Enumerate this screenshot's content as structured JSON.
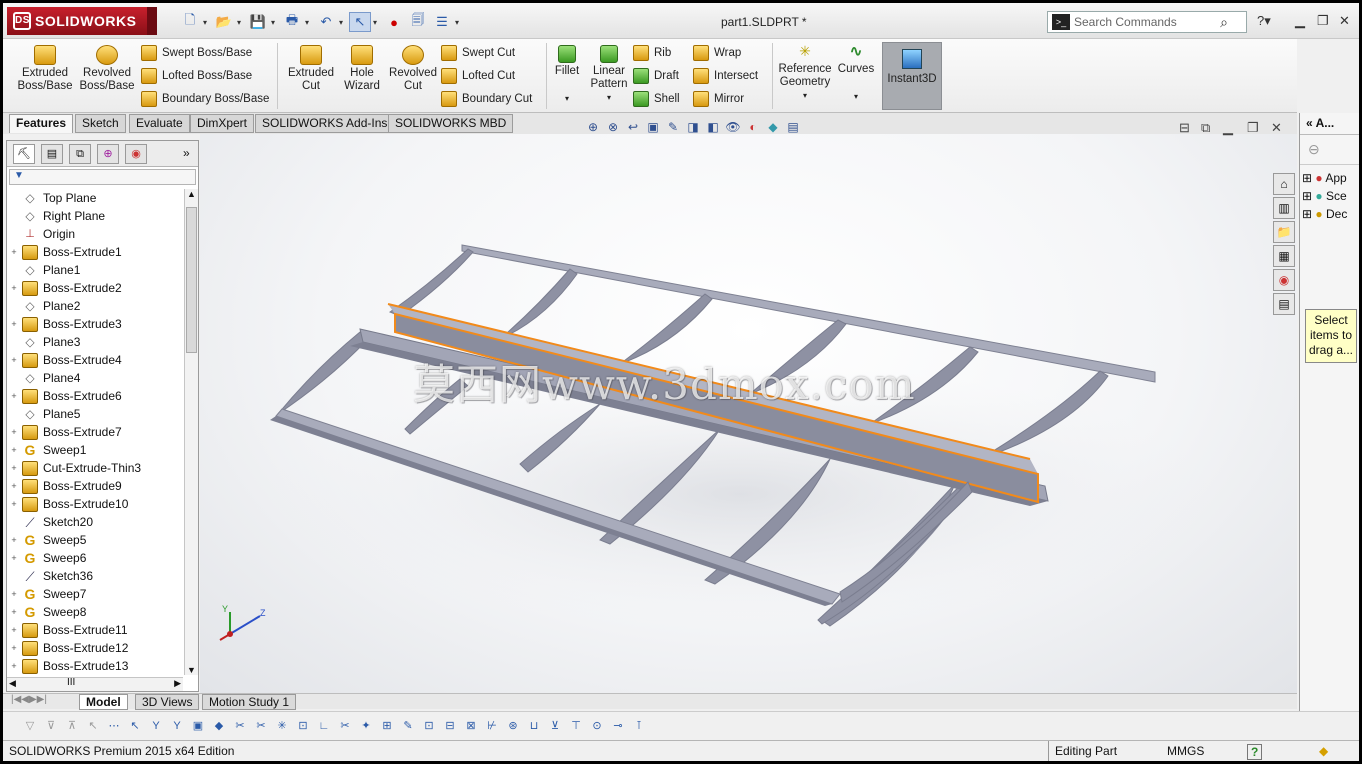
{
  "app": {
    "brand": "SOLIDWORKS",
    "document_title": "part1.SLDPRT *"
  },
  "search": {
    "placeholder": "Search Commands"
  },
  "ribbon": {
    "extruded_boss": "Extruded Boss/Base",
    "revolved_boss": "Revolved Boss/Base",
    "swept_boss": "Swept Boss/Base",
    "lofted_boss": "Lofted Boss/Base",
    "boundary_boss": "Boundary Boss/Base",
    "extruded_cut": "Extruded Cut",
    "hole_wizard": "Hole Wizard",
    "revolved_cut": "Revolved Cut",
    "swept_cut": "Swept Cut",
    "lofted_cut": "Lofted Cut",
    "boundary_cut": "Boundary Cut",
    "fillet": "Fillet",
    "linear_pattern": "Linear Pattern",
    "rib": "Rib",
    "draft": "Draft",
    "shell": "Shell",
    "wrap": "Wrap",
    "intersect": "Intersect",
    "mirror": "Mirror",
    "reference_geometry": "Reference Geometry",
    "curves": "Curves",
    "instant3d": "Instant3D"
  },
  "tabs": [
    "Features",
    "Sketch",
    "Evaluate",
    "DimXpert",
    "SOLIDWORKS Add-Ins",
    "SOLIDWORKS MBD"
  ],
  "feature_tree": [
    {
      "label": "Top Plane",
      "type": "plane",
      "expand": ""
    },
    {
      "label": "Right Plane",
      "type": "plane",
      "expand": ""
    },
    {
      "label": "Origin",
      "type": "origin",
      "expand": ""
    },
    {
      "label": "Boss-Extrude1",
      "type": "extrude",
      "expand": "+"
    },
    {
      "label": "Plane1",
      "type": "plane",
      "expand": ""
    },
    {
      "label": "Boss-Extrude2",
      "type": "extrude",
      "expand": "+"
    },
    {
      "label": "Plane2",
      "type": "plane",
      "expand": ""
    },
    {
      "label": "Boss-Extrude3",
      "type": "extrude",
      "expand": "+"
    },
    {
      "label": "Plane3",
      "type": "plane",
      "expand": ""
    },
    {
      "label": "Boss-Extrude4",
      "type": "extrude",
      "expand": "+"
    },
    {
      "label": "Plane4",
      "type": "plane",
      "expand": ""
    },
    {
      "label": "Boss-Extrude6",
      "type": "extrude",
      "expand": "+"
    },
    {
      "label": "Plane5",
      "type": "plane",
      "expand": ""
    },
    {
      "label": "Boss-Extrude7",
      "type": "extrude",
      "expand": "+"
    },
    {
      "label": "Sweep1",
      "type": "sweep",
      "expand": "+"
    },
    {
      "label": "Cut-Extrude-Thin3",
      "type": "extrude",
      "expand": "+"
    },
    {
      "label": "Boss-Extrude9",
      "type": "extrude",
      "expand": "+"
    },
    {
      "label": "Boss-Extrude10",
      "type": "extrude",
      "expand": "+"
    },
    {
      "label": "Sketch20",
      "type": "sketch",
      "expand": ""
    },
    {
      "label": "Sweep5",
      "type": "sweep",
      "expand": "+"
    },
    {
      "label": "Sweep6",
      "type": "sweep",
      "expand": "+"
    },
    {
      "label": "Sketch36",
      "type": "sketch",
      "expand": ""
    },
    {
      "label": "Sweep7",
      "type": "sweep",
      "expand": "+"
    },
    {
      "label": "Sweep8",
      "type": "sweep",
      "expand": "+"
    },
    {
      "label": "Boss-Extrude11",
      "type": "extrude",
      "expand": "+"
    },
    {
      "label": "Boss-Extrude12",
      "type": "extrude",
      "expand": "+"
    },
    {
      "label": "Boss-Extrude13",
      "type": "extrude",
      "expand": "+"
    }
  ],
  "bottom_tabs": [
    "Model",
    "3D Views",
    "Motion Study 1"
  ],
  "right_pane": {
    "title": "A...",
    "items": [
      "App",
      "Sce",
      "Dec"
    ],
    "tooltip": "Select items to drag a..."
  },
  "status": {
    "edition": "SOLIDWORKS Premium 2015 x64 Edition",
    "mode": "Editing Part",
    "units": "MMGS",
    "help": "?"
  },
  "watermark": "莫西网www.3dmox.com",
  "colors": {
    "model": "#8e91a3",
    "selection": "#f28a1a",
    "brand": "#b01822"
  }
}
